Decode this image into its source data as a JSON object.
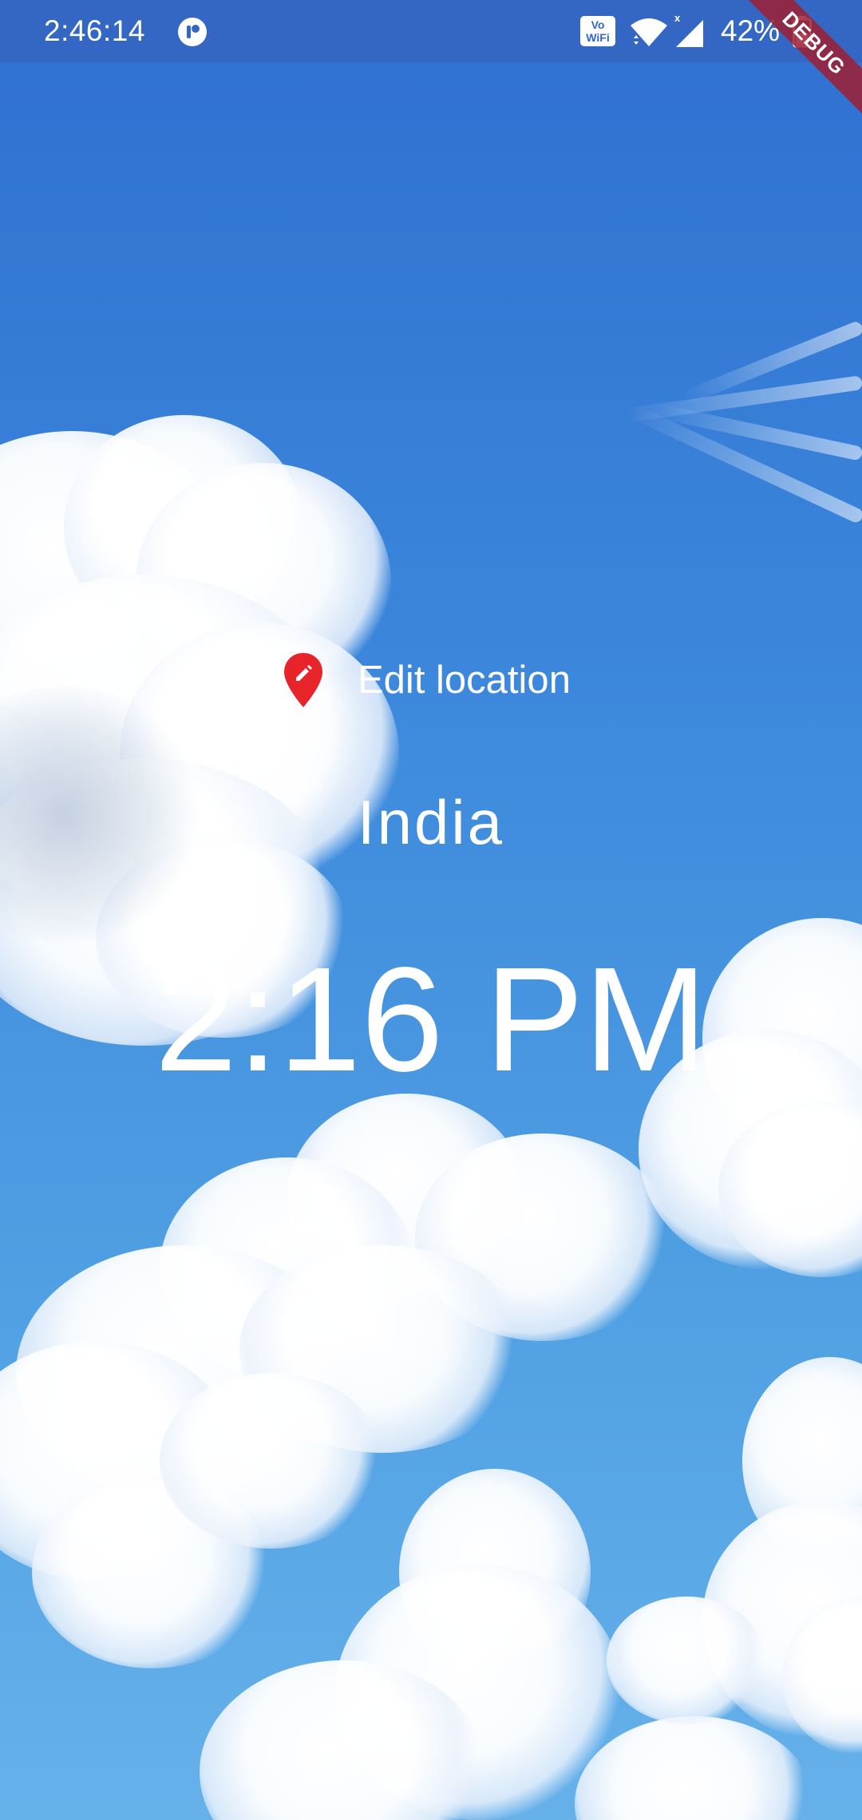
{
  "status_bar": {
    "time": "2:46:14",
    "vowifi_top": "Vo",
    "vowifi_bottom": "WiFi",
    "battery": "42%",
    "icons": [
      "app-icon",
      "vowifi-icon",
      "wifi-icon",
      "signal-icon",
      "battery-icon"
    ]
  },
  "debug_banner": "DEBUG",
  "main": {
    "edit_location_label": "Edit location",
    "edit_location_icon": "location-pin-edit-icon",
    "location": "India",
    "time": "2:16 PM"
  },
  "colors": {
    "status_bar": "#3467c4",
    "pin": "#e8242b",
    "text": "#ffffff",
    "sky_top": "#2f6fd0",
    "sky_bottom": "#66b1ea"
  }
}
